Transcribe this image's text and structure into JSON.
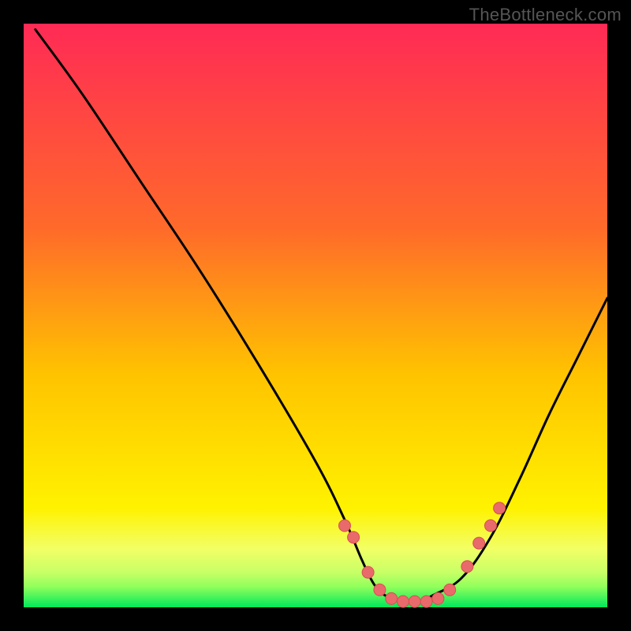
{
  "watermark": "TheBottleneck.com",
  "colors": {
    "bg": "#000000",
    "gradient_top": "#ff2a55",
    "gradient_mid1": "#ff6a2a",
    "gradient_mid2": "#ffc300",
    "gradient_mid3": "#fff200",
    "gradient_bottom": "#00e85c",
    "curve": "#000000",
    "dot_fill": "#e96a6a",
    "dot_stroke": "#d84e52"
  },
  "chart_data": {
    "type": "line",
    "title": "",
    "xlabel": "",
    "ylabel": "",
    "xlim": [
      0,
      100
    ],
    "ylim": [
      0,
      100
    ],
    "series": [
      {
        "name": "bottleneck-curve",
        "x": [
          2,
          10,
          20,
          30,
          40,
          50,
          55,
          58,
          60,
          62,
          65,
          68,
          70,
          75,
          80,
          85,
          90,
          95,
          100
        ],
        "y": [
          99,
          88,
          73,
          58,
          42,
          25,
          15,
          8,
          4,
          2,
          1,
          1,
          2,
          5,
          12,
          22,
          33,
          43,
          53
        ]
      }
    ],
    "markers": {
      "name": "highlight-dots",
      "x": [
        55,
        56.5,
        59,
        61,
        63,
        65,
        67,
        69,
        71,
        73,
        76,
        78,
        80,
        81.5
      ],
      "y": [
        14,
        12,
        6,
        3,
        1.5,
        1,
        1,
        1,
        1.5,
        3,
        7,
        11,
        14,
        17
      ]
    }
  }
}
